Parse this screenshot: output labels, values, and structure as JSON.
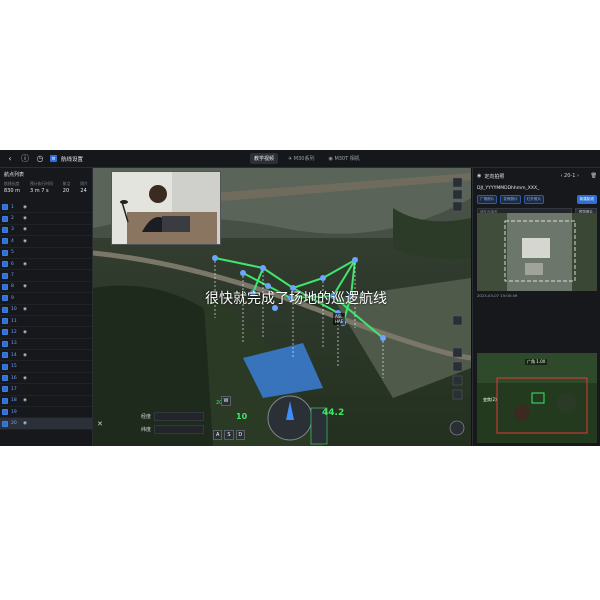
{
  "topbar": {
    "title": "航线设置",
    "tabs": [
      "教学视频",
      "M30系列",
      "M30T 相机"
    ],
    "icons": [
      "back-icon",
      "info-icon",
      "clock-icon",
      "route-icon"
    ]
  },
  "left_panel": {
    "title": "航点列表",
    "stats": [
      {
        "label": "航线长度",
        "value": "830 m"
      },
      {
        "label": "预计执行时间",
        "value": "3 m 7 s"
      },
      {
        "label": "航点",
        "value": "20"
      },
      {
        "label": "照片",
        "value": "24"
      }
    ],
    "waypoints": [
      "1",
      "2",
      "3",
      "4",
      "5",
      "6",
      "7",
      "8",
      "9",
      "10",
      "11",
      "12",
      "13",
      "14",
      "15",
      "16",
      "17",
      "18",
      "19",
      "20"
    ],
    "selected_waypoint": "20"
  },
  "map": {
    "overlay_labels": [
      "起飞点",
      "经度",
      "纬度",
      "ASL",
      "HAE",
      "10",
      "44.2",
      "20",
      "W",
      "A",
      "S",
      "D",
      "Q",
      "E",
      "C"
    ],
    "subtitle": "很快就完成了场地的巡逻航线"
  },
  "right_panel": {
    "title": "定向拍照",
    "page": "20-1",
    "filename": "DJI_YYYYMMDDhhmm_XXX_",
    "tags": [
      "广角照片",
      "变焦照片",
      "红外照片"
    ],
    "tag_button": "新建航线",
    "search_placeholder": "请在此填写",
    "search_button": "预览照片",
    "photo_time": "2023-03-07 15:00:49",
    "zoom_label": "广角 1.0X",
    "zoom_label2": "变焦(2)"
  },
  "colors": {
    "accent": "#2f6fd8",
    "route": "#3ee66b",
    "bg": "#0f1114"
  }
}
